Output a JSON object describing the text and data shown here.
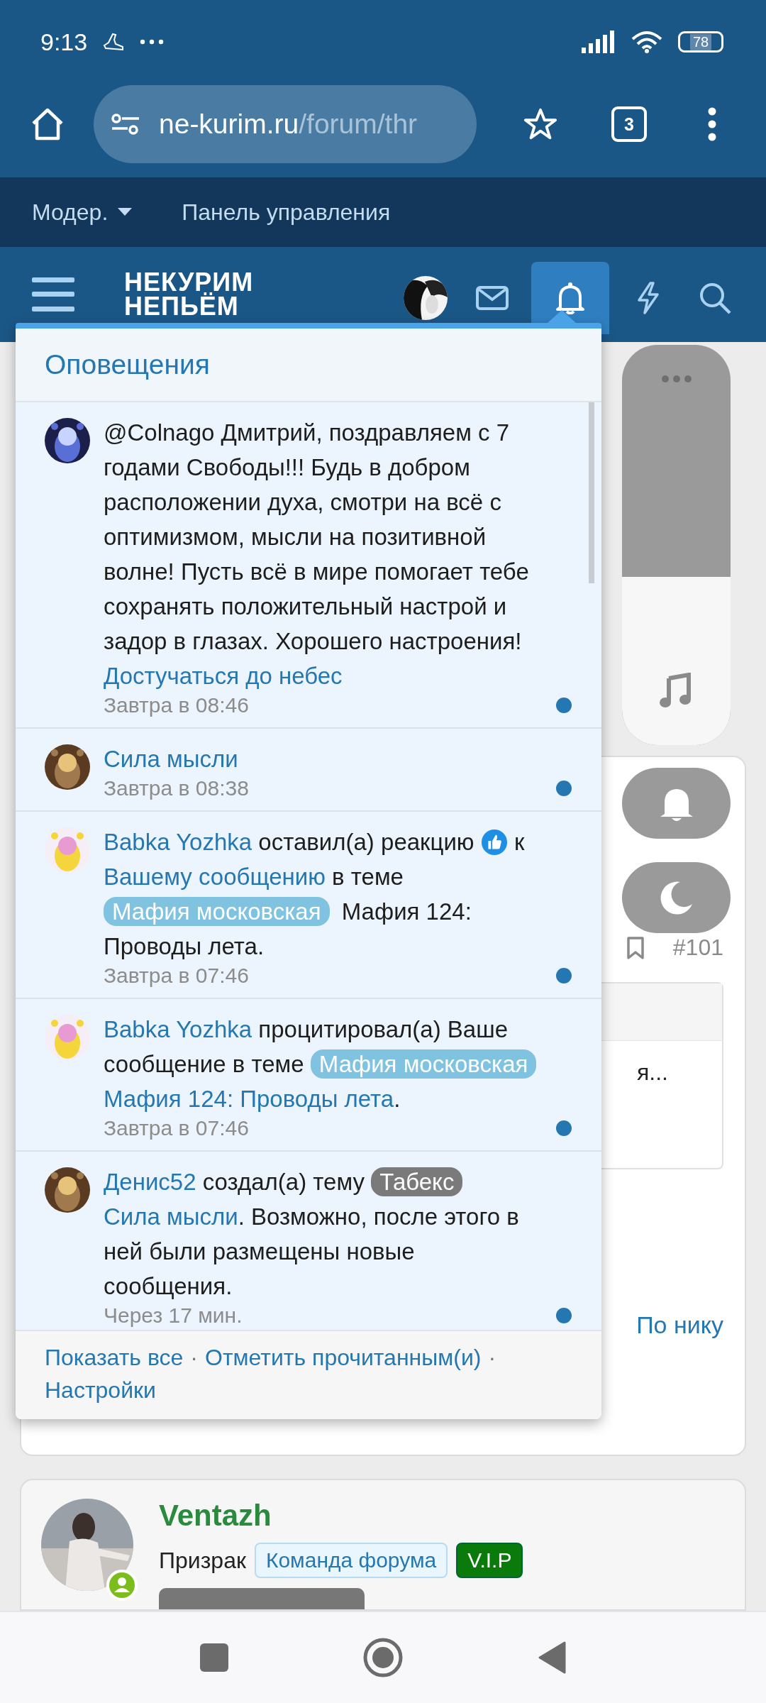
{
  "status_bar": {
    "time": "9:13",
    "battery": "78"
  },
  "browser": {
    "url_host": "ne-kurim.ru",
    "url_path": "/forum/thr",
    "tab_count": "3"
  },
  "mod_bar": {
    "items": [
      {
        "label": "Модер.",
        "dropdown": true
      },
      {
        "label": "Панель управления",
        "dropdown": false
      }
    ]
  },
  "site_nav": {
    "logo_lines": [
      "НЕКУРИМ",
      "НЕПЬЁМ"
    ],
    "items": [
      {
        "kind": "avatar",
        "selected": false
      },
      {
        "kind": "mail",
        "selected": false
      },
      {
        "kind": "bell",
        "selected": true
      },
      {
        "kind": "flash",
        "selected": false
      },
      {
        "kind": "search",
        "selected": false
      }
    ]
  },
  "notifications": {
    "title": "Оповещения",
    "items": [
      {
        "unread": true,
        "time": "Завтра в 08:46",
        "parts": [
          {
            "kind": "text",
            "text": "@Colnago Дмитрий, поздравляем с 7 годами Свободы!!! Будь в добром расположении духа, смотри на всё с оптимизмом, мысли на позитивной волне! Пусть всё в мире помогает тебе сохранять положительный настрой и задор в глазах. Хорошего настроения!"
          },
          {
            "kind": "title_link",
            "text": "Достучаться до небес"
          }
        ]
      },
      {
        "unread": true,
        "time": "Завтра в 08:38",
        "parts": [
          {
            "kind": "link",
            "text": "Сила мысли"
          }
        ]
      },
      {
        "unread": true,
        "time": "Завтра в 07:46",
        "parts": [
          {
            "kind": "link",
            "text": "Babka Yozhka"
          },
          {
            "kind": "text",
            "text": " оставил(а) реакцию "
          },
          {
            "kind": "reaction"
          },
          {
            "kind": "text",
            "text": " к "
          },
          {
            "kind": "link",
            "text": "Вашему сообщению"
          },
          {
            "kind": "text",
            "text": " в теме "
          },
          {
            "kind": "tag",
            "text": "Мафия московская",
            "color": "#7fc3e0"
          },
          {
            "kind": "text",
            "text": " Мафия 124: Проводы лета."
          }
        ]
      },
      {
        "unread": true,
        "time": "Завтра в 07:46",
        "parts": [
          {
            "kind": "link",
            "text": "Babka Yozhka"
          },
          {
            "kind": "text",
            "text": " процитировал(а) Ваше сообщение в теме "
          },
          {
            "kind": "tag",
            "text": "Мафия московская",
            "color": "#7fc3e0"
          },
          {
            "kind": "link",
            "text": " Мафия 124: Проводы лета"
          },
          {
            "kind": "text",
            "text": "."
          }
        ]
      },
      {
        "unread": true,
        "time": "Через 17 мин.",
        "parts": [
          {
            "kind": "link",
            "text": "Денис52"
          },
          {
            "kind": "text",
            "text": " создал(а) тему "
          },
          {
            "kind": "tag",
            "text": "Табекс",
            "color": "#7a7a7a"
          },
          {
            "kind": "link",
            "text": "Сила мысли"
          },
          {
            "kind": "text",
            "text": ". Возможно, после этого в ней были размещены новые сообщения."
          }
        ]
      }
    ],
    "footer": {
      "separator": "·",
      "links": [
        "Показать все",
        "Отметить прочитанным(и)",
        "Настройки"
      ]
    }
  },
  "volume": {
    "level": 0.42
  },
  "post": {
    "number": "#101",
    "quote_text": "я...",
    "sort_link": "По нику"
  },
  "member": {
    "name": "Ventazh",
    "title": "Призрак",
    "badges": [
      {
        "text": "Команда форума",
        "kind": "team"
      },
      {
        "text": "V.I.P",
        "kind": "vip"
      }
    ]
  }
}
